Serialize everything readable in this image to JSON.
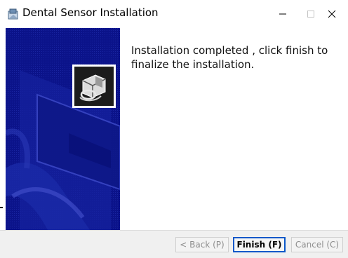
{
  "window": {
    "title": "Dental Sensor Installation",
    "icon": "installer-icon",
    "controls": [
      "minimize-icon",
      "maximize-icon",
      "close-icon"
    ]
  },
  "content": {
    "message": "Installation completed , click finish to finalize the installation."
  },
  "sidebar": {
    "logo": "sensor-logo-icon"
  },
  "buttons": {
    "back_label": "< Back (P)",
    "finish_label": "Finish (F)",
    "cancel_label": "Cancel (C)"
  },
  "colors": {
    "sidebar_blue": "#0b138a",
    "accent": "#0a58c9"
  }
}
